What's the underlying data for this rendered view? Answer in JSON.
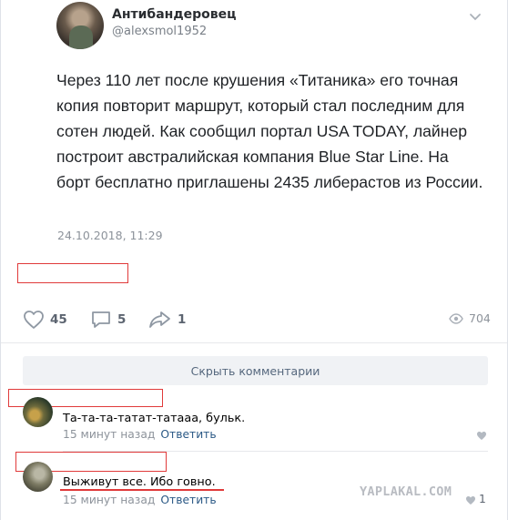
{
  "post": {
    "author": "Антибандеровец",
    "handle": "@alexsmol1952",
    "text": "Через 110 лет после крушения «Титаника» его точная копия повторит маршрут, который стал последним для сотен людей. Как сообщил портал USA TODAY, лайнер построит австралийская компания Blue Star Line. На борт бесплатно приглашены 2435 либерастов из России.",
    "date": "24.10.2018, 11:29"
  },
  "actions": {
    "likes": "45",
    "comments": "5",
    "shares": "1",
    "views": "704"
  },
  "comments": {
    "hide_label": "Скрыть комментарии",
    "items": [
      {
        "text": "Та-та-та-татат-татааа, бульк.",
        "time": "15 минут назад",
        "reply": "Ответить"
      },
      {
        "text": "Выживут все. Ибо говно.",
        "time": "15 минут назад",
        "reply": "Ответить",
        "likes": "1"
      }
    ]
  },
  "watermark": "YAPLAKAL.COM",
  "colors": {
    "redaction": "#e03a3a",
    "link": "#2a5885",
    "muted": "#8d939b"
  }
}
